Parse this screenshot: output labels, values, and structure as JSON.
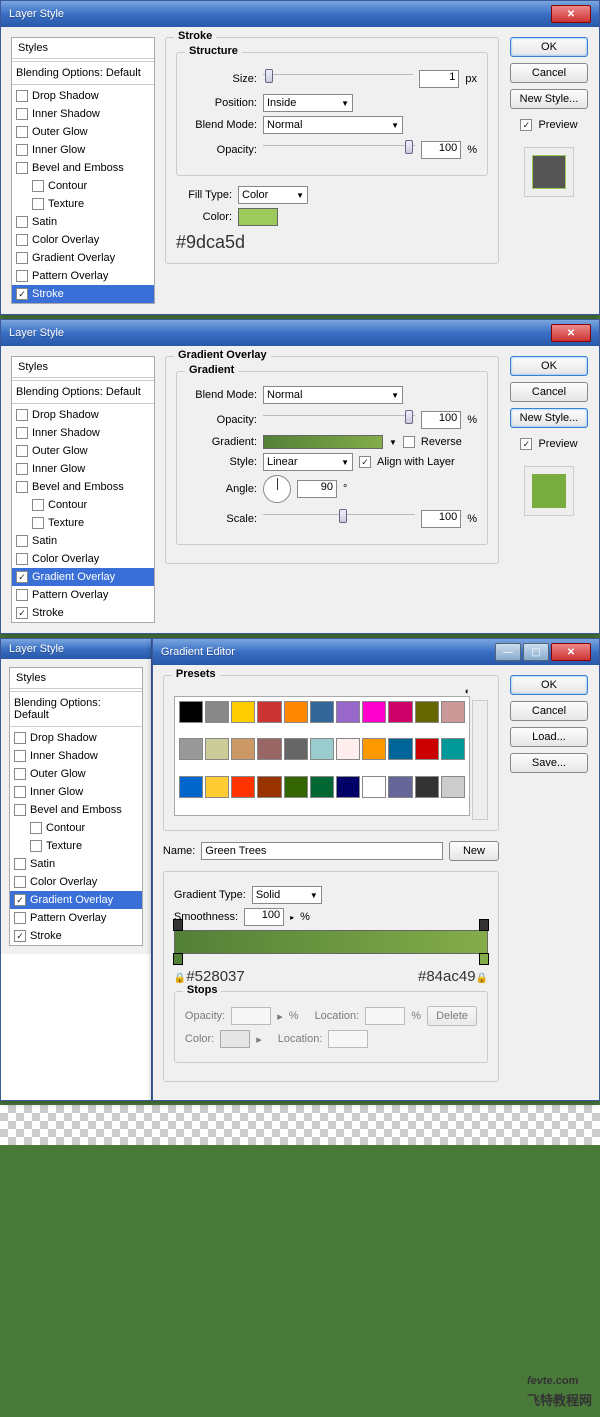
{
  "dialog1": {
    "title": "Layer Style",
    "sidebar_header": "Styles",
    "blending": "Blending Options: Default",
    "items": [
      "Drop Shadow",
      "Inner Shadow",
      "Outer Glow",
      "Inner Glow",
      "Bevel and Emboss",
      "Contour",
      "Texture",
      "Satin",
      "Color Overlay",
      "Gradient Overlay",
      "Pattern Overlay",
      "Stroke"
    ],
    "selected": "Stroke",
    "panel_title": "Stroke",
    "structure": "Structure",
    "size_label": "Size:",
    "size_value": "1",
    "px": "px",
    "position_label": "Position:",
    "position_value": "Inside",
    "blendmode_label": "Blend Mode:",
    "blendmode_value": "Normal",
    "opacity_label": "Opacity:",
    "opacity_value": "100",
    "pct": "%",
    "filltype_label": "Fill Type:",
    "filltype_value": "Color",
    "color_label": "Color:",
    "color_hex": "#9dca5d",
    "ok": "OK",
    "cancel": "Cancel",
    "newstyle": "New Style...",
    "preview": "Preview"
  },
  "dialog2": {
    "title": "Layer Style",
    "selected": "Gradient Overlay",
    "checked": [
      "Gradient Overlay",
      "Stroke"
    ],
    "panel_title": "Gradient Overlay",
    "gradient": "Gradient",
    "blendmode_label": "Blend Mode:",
    "blendmode_value": "Normal",
    "opacity_label": "Opacity:",
    "opacity_value": "100",
    "gradient_label": "Gradient:",
    "reverse": "Reverse",
    "style_label": "Style:",
    "style_value": "Linear",
    "align": "Align with Layer",
    "angle_label": "Angle:",
    "angle_value": "90",
    "deg": "°",
    "scale_label": "Scale:",
    "scale_value": "100",
    "ok": "OK",
    "cancel": "Cancel",
    "newstyle": "New Style...",
    "preview": "Preview",
    "preview_color": "#7aad3f"
  },
  "dialog3": {
    "title_left": "Layer Style",
    "title_right": "Gradient Editor",
    "presets": "Presets",
    "preset_colors": [
      "#000",
      "#888",
      "#fc0",
      "#c33",
      "#f80",
      "#369",
      "#96c",
      "#f0c",
      "#c06",
      "#660",
      "#c99",
      "#999",
      "#cc9",
      "#c96",
      "#966",
      "#666",
      "#9cc",
      "#fee",
      "#f90",
      "#069",
      "#c00",
      "#099",
      "#06c",
      "#fc3",
      "#f30",
      "#930",
      "#360",
      "#063",
      "#006",
      "#fff",
      "#669",
      "#333",
      "#ccc"
    ],
    "name_label": "Name:",
    "name_value": "Green Trees",
    "new": "New",
    "gradtype_label": "Gradient Type:",
    "gradtype_value": "Solid",
    "smooth_label": "Smoothness:",
    "smooth_value": "100",
    "stops": "Stops",
    "opacity_label": "Opacity:",
    "location_label": "Location:",
    "delete": "Delete",
    "color_label": "Color:",
    "hex_left": "#528037",
    "hex_right": "#84ac49",
    "ok": "OK",
    "cancel": "Cancel",
    "load": "Load...",
    "save": "Save...",
    "selected": "Gradient Overlay",
    "checked": [
      "Gradient Overlay",
      "Stroke"
    ]
  },
  "watermark": {
    "brand": "fevte",
    "dotcom": ".com",
    "sub": "飞特教程网"
  }
}
